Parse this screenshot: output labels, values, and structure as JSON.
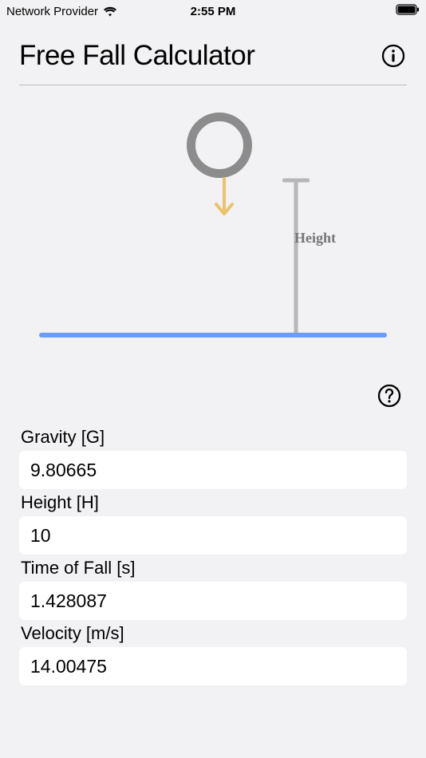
{
  "status": {
    "provider": "Network Provider",
    "time": "2:55 PM"
  },
  "header": {
    "title": "Free Fall Calculator"
  },
  "diagram": {
    "height_label": "Height"
  },
  "fields": {
    "gravity": {
      "label": "Gravity [G]",
      "value": "9.80665"
    },
    "height": {
      "label": "Height [H]",
      "value": "10"
    },
    "time": {
      "label": "Time of Fall [s]",
      "value": "1.428087"
    },
    "velocity": {
      "label": "Velocity [m/s]",
      "value": "14.00475"
    }
  }
}
